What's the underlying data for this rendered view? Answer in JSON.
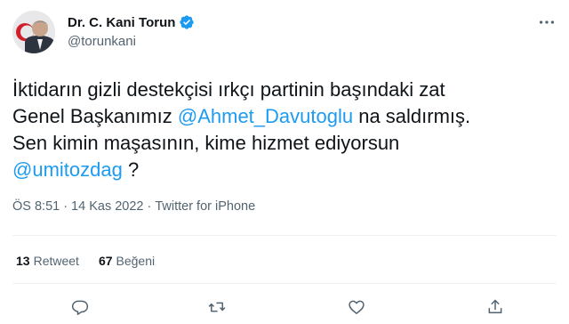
{
  "author": {
    "name": "Dr. C. Kani Torun",
    "handle": "@torunkani",
    "verified": true
  },
  "tweet": {
    "line1": "İktidarın gizli destekçisi ırkçı partinin başındaki zat",
    "line2_prefix": "Genel Başkanımız ",
    "mention1": "@Ahmet_Davutoglu",
    "line2_suffix": " na saldırmış.",
    "line3": "Sen kimin maşasının, kime hizmet ediyorsun",
    "mention2": "@umitozdag",
    "line4_suffix": " ?"
  },
  "meta": {
    "time": "ÖS 8:51",
    "separator1": "·",
    "date": "14 Kas 2022",
    "separator2": "·",
    "source": "Twitter for iPhone"
  },
  "stats": {
    "retweets_count": "13",
    "retweets_label": "Retweet",
    "likes_count": "67",
    "likes_label": "Beğeni"
  },
  "colors": {
    "accent": "#1d9bf0",
    "secondary_text": "#536471"
  },
  "icons": {
    "verified": "verified-badge-icon",
    "more": "more-options-icon",
    "reply": "reply-icon",
    "retweet": "retweet-icon",
    "like": "heart-icon",
    "share": "share-icon"
  }
}
